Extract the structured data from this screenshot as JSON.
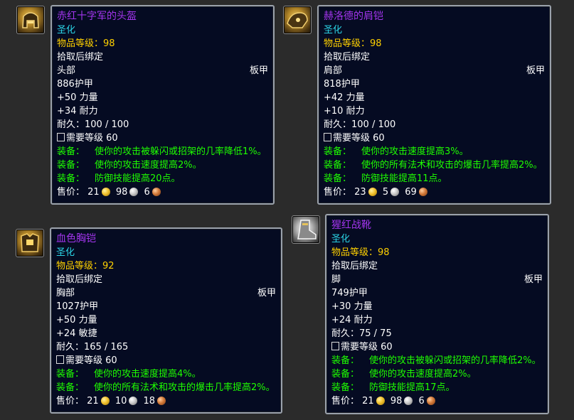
{
  "colors": {
    "epic": "#a335ee",
    "set_cyan": "#2bd4e6",
    "item_level": "#ffd100",
    "equip_green": "#1eff00",
    "panel_bg": "#050b22",
    "border": "#9aa1ab"
  },
  "items": [
    {
      "icon": "helmet-icon",
      "name": "赤红十字军的头盔",
      "tag": "圣化",
      "item_level": "物品等级：98",
      "bind": "拾取后绑定",
      "slot": "头部",
      "armor_type": "板甲",
      "armor": "886护甲",
      "stats": [
        "+50 力量",
        "+34 耐力"
      ],
      "durability": "耐久：100 / 100",
      "required_level": "需要等级 60",
      "equips": [
        {
          "label": "装备：",
          "text": "使你的攻击被躲闪或招架的几率降低1%。"
        },
        {
          "label": "装备：",
          "text": "使你的攻击速度提高2%。"
        },
        {
          "label": "装备：",
          "text": "防御技能提高20点。"
        }
      ],
      "sell": {
        "label": "售价：",
        "gold": "21",
        "silver": "98",
        "copper": "6"
      }
    },
    {
      "icon": "shoulder-icon",
      "name": "赫洛德的肩铠",
      "tag": "圣化",
      "item_level": "物品等级：98",
      "bind": "拾取后绑定",
      "slot": "肩部",
      "armor_type": "板甲",
      "armor": "818护甲",
      "stats": [
        "+42 力量",
        "+10 耐力"
      ],
      "durability": "耐久：100 / 100",
      "required_level": "需要等级 60",
      "equips": [
        {
          "label": "装备：",
          "text": "使你的攻击速度提高3%。"
        },
        {
          "label": "装备：",
          "text": "使你的所有法术和攻击的爆击几率提高2%。"
        },
        {
          "label": "装备：",
          "text": "防御技能提高11点。"
        }
      ],
      "sell": {
        "label": "售价：",
        "gold": "23",
        "silver": "5",
        "copper": "69"
      }
    },
    {
      "icon": "chest-icon",
      "name": "血色胸铠",
      "tag": "圣化",
      "item_level": "物品等级：92",
      "bind": "拾取后绑定",
      "slot": "胸部",
      "armor_type": "板甲",
      "armor": "1027护甲",
      "stats": [
        "+50 力量",
        "+24 敏捷"
      ],
      "durability": "耐久：165 / 165",
      "required_level": "需要等级 60",
      "equips": [
        {
          "label": "装备：",
          "text": "使你的攻击速度提高4%。"
        },
        {
          "label": "装备：",
          "text": "使你的所有法术和攻击的爆击几率提高2%。"
        }
      ],
      "sell": {
        "label": "售价：",
        "gold": "21",
        "silver": "10",
        "copper": "18"
      }
    },
    {
      "icon": "boots-icon",
      "name": "猩红战靴",
      "tag": "圣化",
      "item_level": "物品等级：98",
      "bind": "拾取后绑定",
      "slot": "脚",
      "armor_type": "板甲",
      "armor": "749护甲",
      "stats": [
        "+30 力量",
        "+24 耐力"
      ],
      "durability": "耐久：75 / 75",
      "required_level": "需要等级 60",
      "equips": [
        {
          "label": "装备：",
          "text": "使你的攻击被躲闪或招架的几率降低2%。"
        },
        {
          "label": "装备：",
          "text": "使你的攻击速度提高2%。"
        },
        {
          "label": "装备：",
          "text": "防御技能提高17点。"
        }
      ],
      "sell": {
        "label": "售价：",
        "gold": "21",
        "silver": "98",
        "copper": "6"
      }
    }
  ]
}
